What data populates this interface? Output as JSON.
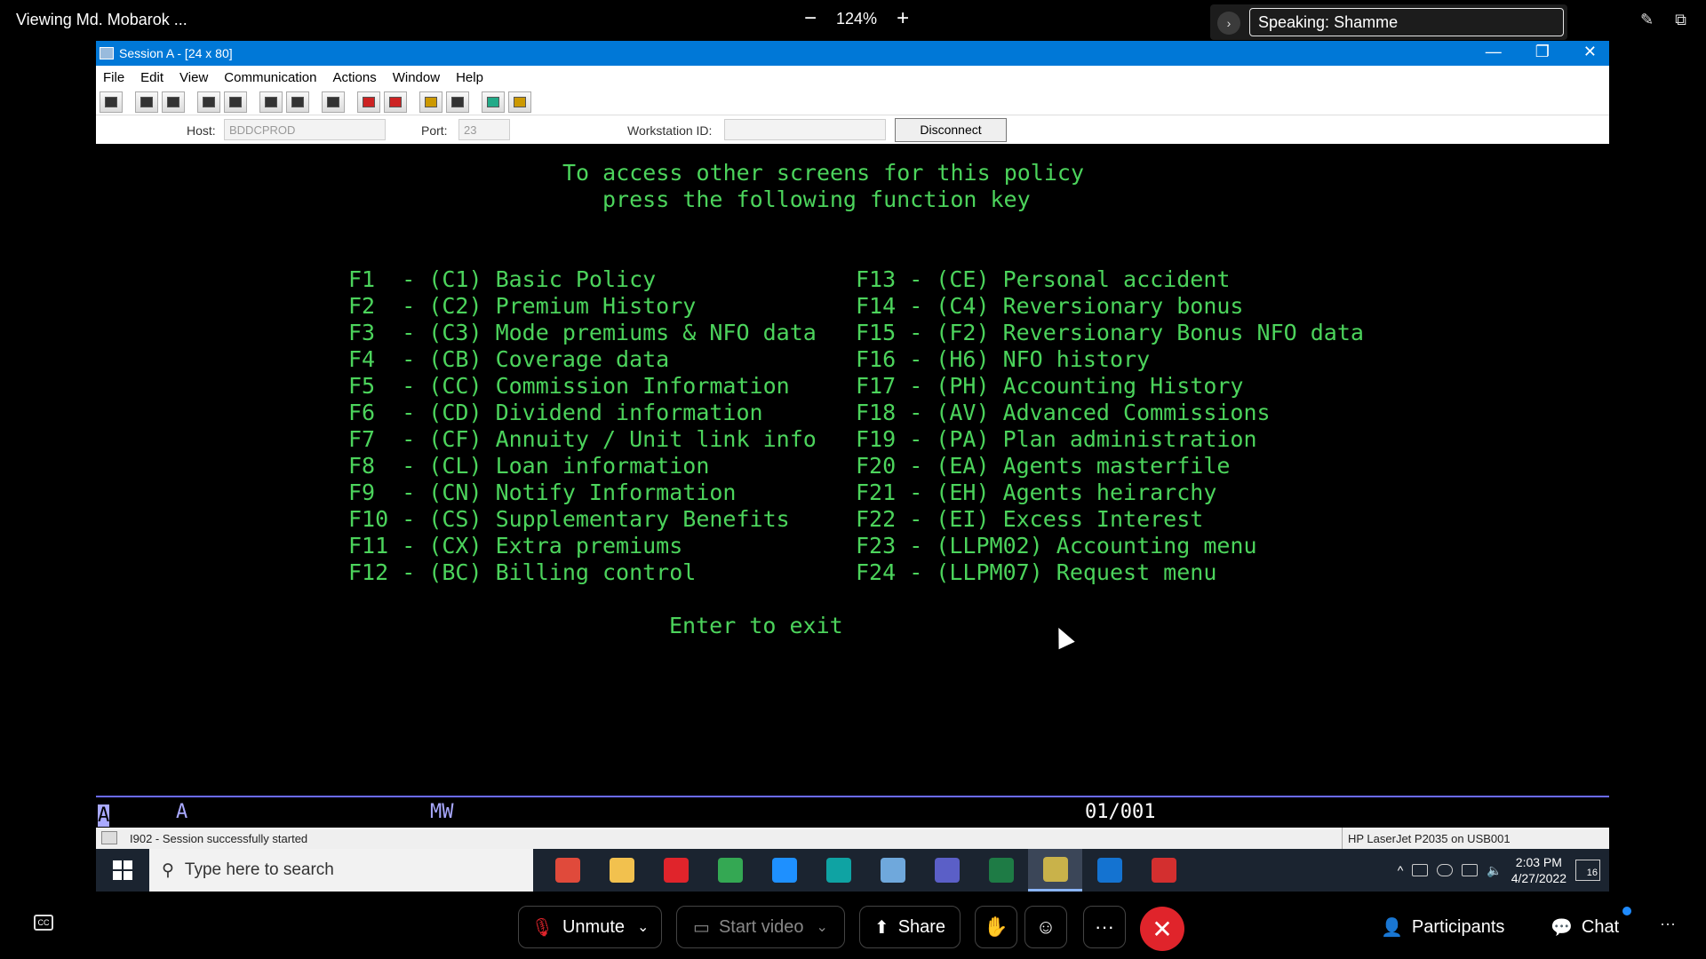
{
  "meeting": {
    "viewing": "Viewing Md. Mobarok ...",
    "zoom_minus": "−",
    "zoom_level": "124%",
    "zoom_plus": "+",
    "speaking_label": "Speaking:",
    "speaking_name": "Shamme",
    "bottom": {
      "unmute": "Unmute",
      "start_video": "Start video",
      "share": "Share",
      "more": "···",
      "participants": "Participants",
      "chat": "Chat",
      "overflow": "···"
    }
  },
  "window": {
    "title": "Session A - [24 x 80]",
    "menu": [
      "File",
      "Edit",
      "View",
      "Communication",
      "Actions",
      "Window",
      "Help"
    ],
    "host_label": "Host:",
    "host_value": "BDDCPROD",
    "port_label": "Port:",
    "port_value": "23",
    "workstation_label": "Workstation ID:",
    "workstation_value": "",
    "disconnect": "Disconnect"
  },
  "terminal": {
    "header1": "To access other screens for this policy",
    "header2": "press the following function key",
    "left": [
      "F1  - (C1) Basic Policy",
      "F2  - (C2) Premium History",
      "F3  - (C3) Mode premiums & NFO data",
      "F4  - (CB) Coverage data",
      "F5  - (CC) Commission Information",
      "F6  - (CD) Dividend information",
      "F7  - (CF) Annuity / Unit link info",
      "F8  - (CL) Loan information",
      "F9  - (CN) Notify Information",
      "F10 - (CS) Supplementary Benefits",
      "F11 - (CX) Extra premiums",
      "F12 - (BC) Billing control"
    ],
    "right": [
      "F13 - (CE) Personal accident",
      "F14 - (C4) Reversionary bonus",
      "F15 - (F2) Reversionary Bonus NFO data",
      "F16 - (H6) NFO history",
      "F17 - (PH) Accounting History",
      "F18 - (AV) Advanced Commissions",
      "F19 - (PA) Plan administration",
      "F20 - (EA) Agents masterfile",
      "F21 - (EH) Agents heirarchy",
      "F22 - (EI) Excess Interest",
      "F23 - (LLPM02) Accounting menu",
      "F24 - (LLPM07) Request menu"
    ],
    "footer": "Enter to exit",
    "oia_ma": "MA",
    "oia_a": "A",
    "oia_mw": "MW",
    "oia_pos": "01/001",
    "message": "I902 - Session successfully started",
    "printer": "HP LaserJet P2035 on USB001"
  },
  "taskbar": {
    "search_placeholder": "Type here to search",
    "time": "2:03 PM",
    "date": "4/27/2022",
    "notif_count": "16",
    "apps": [
      {
        "name": "snip-icon",
        "color": "#e04a3b"
      },
      {
        "name": "file-explorer-icon",
        "color": "#f2c14e"
      },
      {
        "name": "opera-icon",
        "color": "#e0242b"
      },
      {
        "name": "chrome-icon",
        "color": "#34a853"
      },
      {
        "name": "ie-icon",
        "color": "#1e90ff"
      },
      {
        "name": "edge-icon",
        "color": "#0fa3a3"
      },
      {
        "name": "wifi-app-icon",
        "color": "#6fa8dc"
      },
      {
        "name": "teams-icon",
        "color": "#5b5fc7"
      },
      {
        "name": "excel-icon",
        "color": "#1e7b45"
      },
      {
        "name": "terminal-app-icon",
        "color": "#c9b24a"
      },
      {
        "name": "outlook-icon",
        "color": "#1473d1"
      },
      {
        "name": "acrobat-icon",
        "color": "#d32f2f"
      }
    ]
  }
}
